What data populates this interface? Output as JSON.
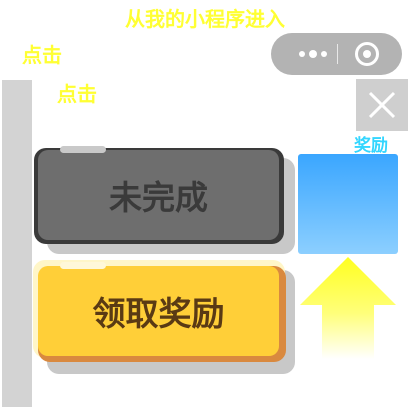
{
  "hints": {
    "top": "从我的小程序进入",
    "click_1": "点击",
    "click_2": "点击"
  },
  "capsule": {
    "more_icon": "more-dots-icon",
    "close_icon": "target-circle-icon"
  },
  "close_icon": "close-x-icon",
  "reward": {
    "label": "奖励",
    "arrow_icon": "up-arrow-icon"
  },
  "buttons": {
    "incomplete_label": "未完成",
    "claim_label": "领取奖励"
  },
  "colors": {
    "hint_yellow": "#ffff33",
    "reward_label_cyan": "#33d6ff",
    "reward_box_top": "#3aa6ff",
    "reward_box_bottom": "#8ccfff",
    "incomplete_button": "#6e6e6e",
    "claim_button": "#ffcf38",
    "claim_text": "#5a3a14"
  }
}
